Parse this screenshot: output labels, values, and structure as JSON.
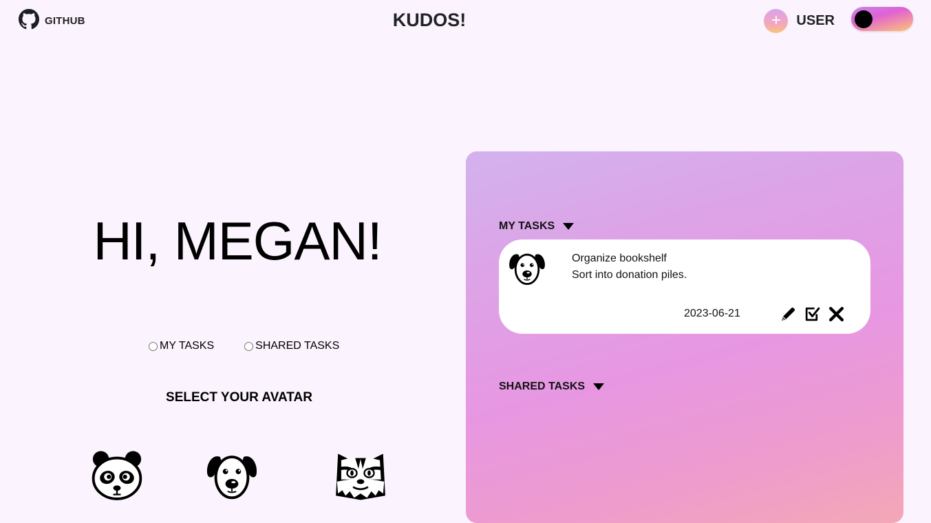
{
  "header": {
    "github_label": "GITHUB",
    "github_icon": "github-icon",
    "app_title": "KUDOS!",
    "add_button_label": "+",
    "user_label": "USER",
    "theme_toggle": {
      "state": "off"
    }
  },
  "greeting": "HI, MEGAN!",
  "task_filter": {
    "options": [
      {
        "label": "MY TASKS",
        "checked": false
      },
      {
        "label": "SHARED TASKS",
        "checked": false
      }
    ]
  },
  "avatar_picker": {
    "heading": "SELECT YOUR AVATAR",
    "avatars": [
      "panda-icon",
      "dog-icon",
      "tiger-icon"
    ]
  },
  "tasks_panel": {
    "my_tasks_label": "MY TASKS",
    "shared_tasks_label": "SHARED TASKS",
    "my_tasks": [
      {
        "avatar": "dog-icon",
        "title": "Organize bookshelf",
        "description": "Sort into donation piles.",
        "date": "2023-06-21",
        "actions": [
          "edit-icon",
          "complete-icon",
          "delete-icon"
        ]
      }
    ],
    "shared_tasks": []
  },
  "colors": {
    "background": "#fbf3fd",
    "panel_gradient_start": "#d3b2ee",
    "panel_gradient_mid": "#e797e2",
    "panel_gradient_end": "#f3a8b6",
    "toggle_gradient_end": "#fdc36a"
  }
}
